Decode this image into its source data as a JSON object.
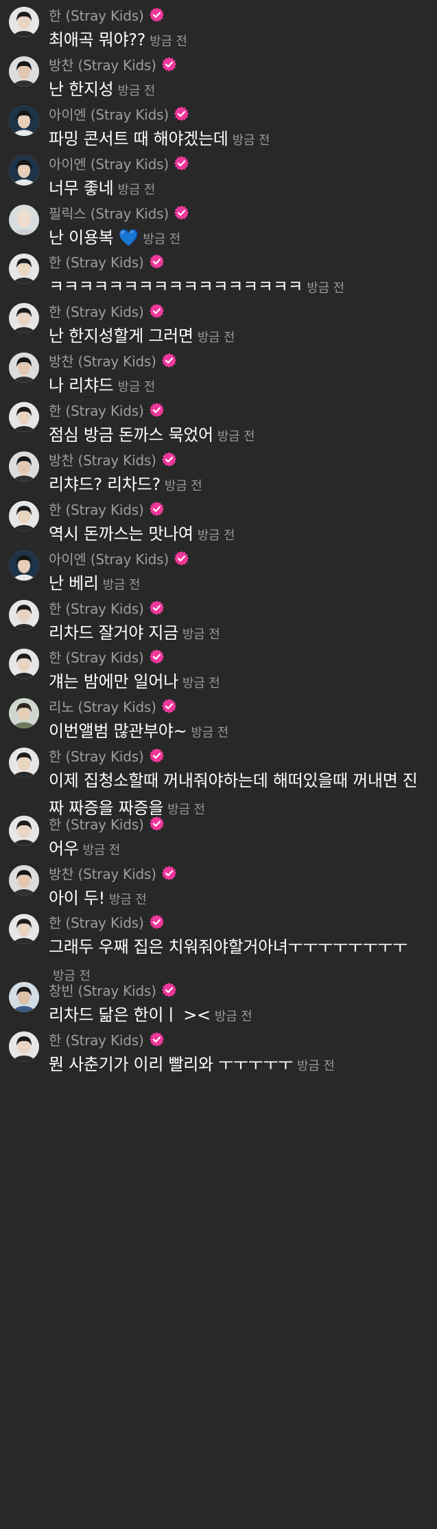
{
  "colors": {
    "background": "#282828",
    "sender_text": "#9e9e9e",
    "message_text": "#ffffff",
    "timestamp_text": "#9a9a9a",
    "verified_badge": "#f0389b"
  },
  "icons": {
    "verified": "verified-badge-icon"
  },
  "messages": [
    {
      "sender": "한 (Stray Kids)",
      "text": "최애곡 뭐야??",
      "time": "방금 전",
      "avatar": "han"
    },
    {
      "sender": "방찬 (Stray Kids)",
      "text": "난 한지성",
      "time": "방금 전",
      "avatar": "bangchan"
    },
    {
      "sender": "아이엔 (Stray Kids)",
      "text": "파밍 콘서트 때 해야겠는데",
      "time": "방금 전",
      "avatar": "in"
    },
    {
      "sender": "아이엔 (Stray Kids)",
      "text": "너무 좋네",
      "time": "방금 전",
      "avatar": "in"
    },
    {
      "sender": "필릭스 (Stray Kids)",
      "text": "난 이용복 💙",
      "time": "방금 전",
      "avatar": "felix"
    },
    {
      "sender": "한 (Stray Kids)",
      "text": "ㅋㅋㅋㅋㅋㅋㅋㅋㅋㅋㅋㅋㅋㅋㅋㅋㅋ",
      "time": "방금 전",
      "avatar": "han"
    },
    {
      "sender": "한 (Stray Kids)",
      "text": "난 한지성할게 그러면",
      "time": "방금 전",
      "avatar": "han"
    },
    {
      "sender": "방찬 (Stray Kids)",
      "text": "나 리챠드",
      "time": "방금 전",
      "avatar": "bangchan"
    },
    {
      "sender": "한 (Stray Kids)",
      "text": "점심 방금 돈까스 묵었어",
      "time": "방금 전",
      "avatar": "han"
    },
    {
      "sender": "방찬 (Stray Kids)",
      "text": "리챠드? 리차드?",
      "time": "방금 전",
      "avatar": "bangchan"
    },
    {
      "sender": "한 (Stray Kids)",
      "text": "역시 돈까스는 맛나여",
      "time": "방금 전",
      "avatar": "han"
    },
    {
      "sender": "아이엔 (Stray Kids)",
      "text": "난 베리",
      "time": "방금 전",
      "avatar": "in"
    },
    {
      "sender": "한 (Stray Kids)",
      "text": "리차드 잘거야 지금",
      "time": "방금 전",
      "avatar": "han"
    },
    {
      "sender": "한 (Stray Kids)",
      "text": "걔는 밤에만 일어나",
      "time": "방금 전",
      "avatar": "han"
    },
    {
      "sender": "리노 (Stray Kids)",
      "text": "이번앨범 많관부야~",
      "time": "방금 전",
      "avatar": "leeknow"
    },
    {
      "sender": "한 (Stray Kids)",
      "text": "이제 집청소할때 꺼내줘야하는데 해떠있을때 꺼내면 진짜 짜증을 짜증을",
      "time": "방금 전",
      "avatar": "han"
    },
    {
      "sender": "한 (Stray Kids)",
      "text": "어우",
      "time": "방금 전",
      "avatar": "han"
    },
    {
      "sender": "방찬 (Stray Kids)",
      "text": "아이 두!",
      "time": "방금 전",
      "avatar": "bangchan"
    },
    {
      "sender": "한 (Stray Kids)",
      "text": "그래두 우째 집은 치워줘야할거아녀ㅜㅜㅜㅜㅜㅜㅜㅜ",
      "time": "방금 전",
      "avatar": "han"
    },
    {
      "sender": "창빈 (Stray Kids)",
      "text": "리차드 닮은 한이ㅣ ><",
      "time": "방금 전",
      "avatar": "changbin"
    },
    {
      "sender": "한 (Stray Kids)",
      "text": "뭔 사춘기가 이리 빨리와 ㅜㅜㅜㅜㅜ",
      "time": "방금 전",
      "avatar": "han"
    }
  ]
}
